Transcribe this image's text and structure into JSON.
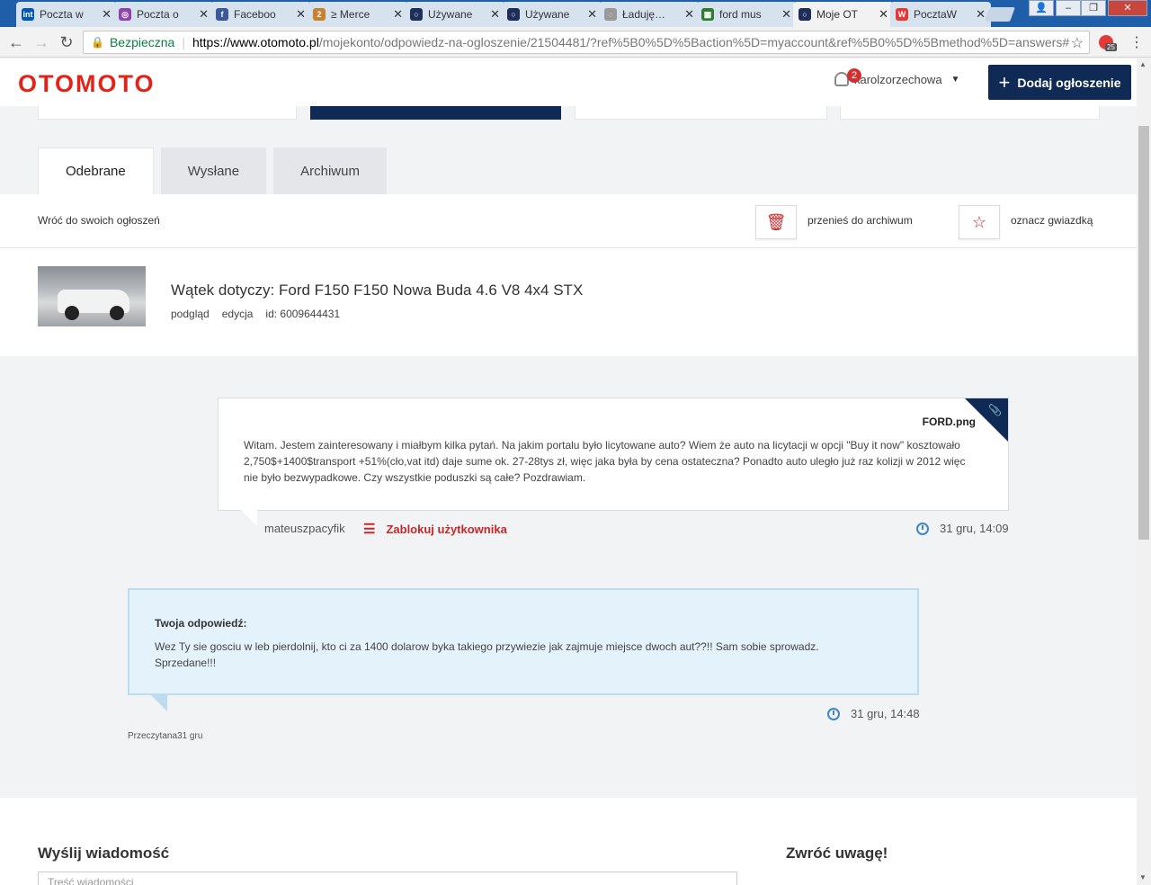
{
  "browser": {
    "tabs": [
      {
        "title": "Poczta w",
        "fav": "int",
        "color": "#0057b8"
      },
      {
        "title": "Poczta o",
        "fav": "◎",
        "color": "#8e44ad"
      },
      {
        "title": "Faceboo",
        "fav": "f",
        "color": "#3b5998"
      },
      {
        "title": "≥ Merce",
        "fav": "2",
        "color": "#c9812f"
      },
      {
        "title": "Używane",
        "fav": "○",
        "color": "#1e2e5a"
      },
      {
        "title": "Używane",
        "fav": "○",
        "color": "#1e2e5a"
      },
      {
        "title": "Ładuję…",
        "fav": "◌",
        "color": "#999999"
      },
      {
        "title": "ford mus",
        "fav": "▦",
        "color": "#2e7d32"
      },
      {
        "title": "Moje OT",
        "fav": "○",
        "color": "#1e2e5a"
      },
      {
        "title": "PocztaW",
        "fav": "W",
        "color": "#e53935"
      }
    ],
    "secure_label": "Bezpieczna",
    "url_host": "https://www.otomoto.pl",
    "url_path": "/mojekonto/odpowiedz-na-ogloszenie/21504481/?ref%5B0%5D%5Baction%5D=myaccount&ref%5B0%5D%5Bmethod%5D=answers#",
    "ext_badge": "25"
  },
  "header": {
    "logo": "OTOMOTO",
    "notifications": "2",
    "username": "karolzorzechowa",
    "add_button": "Dodaj ogłoszenie"
  },
  "tabs": [
    "Odebrane",
    "Wysłane",
    "Archiwum"
  ],
  "toolbar": {
    "back": "Wróć do swoich ogłoszeń",
    "archive": "przenieś do archiwum",
    "star": "oznacz gwiazdką"
  },
  "thread": {
    "title": "Wątek dotyczy: Ford F150 F150 Nowa Buda 4.6 V8 4x4 STX",
    "preview": "podgląd",
    "edit": "edycja",
    "id": "id: 6009644431"
  },
  "message": {
    "attachment": "FORD.png",
    "text": "Witam. Jestem zainteresowany i miałbym kilka pytań. Na jakim portalu było licytowane auto? Wiem że auto na licytacji w opcji \"Buy it now\" kosztowało 2,750$+1400$transport +51%(cło,vat itd) daje sume ok. 27-28tys zł, więc jaka była by cena ostateczna? Ponadto auto uległo już raz kolizji w 2012 więc nie było bezwypadkowe. Czy wszystkie poduszki są całe? Pozdrawiam.",
    "author": "mateuszpacyfik",
    "block": "Zablokuj użytkownika",
    "time": "31 gru, 14:09"
  },
  "reply": {
    "label": "Twoja odpowiedź:",
    "text": "Wez Ty sie gosciu w leb pierdolnij, kto ci za 1400 dolarow byka takiego przywiezie jak zajmuje miejsce dwoch aut??!! Sam sobie sprowadz. Sprzedane!!!",
    "time": "31 gru, 14:48",
    "status": "Przeczytana31 gru"
  },
  "bottom": {
    "send_title": "Wyślij wiadomość",
    "note_title": "Zwróć uwagę!",
    "input_placeholder": "Treść wiadomości"
  }
}
